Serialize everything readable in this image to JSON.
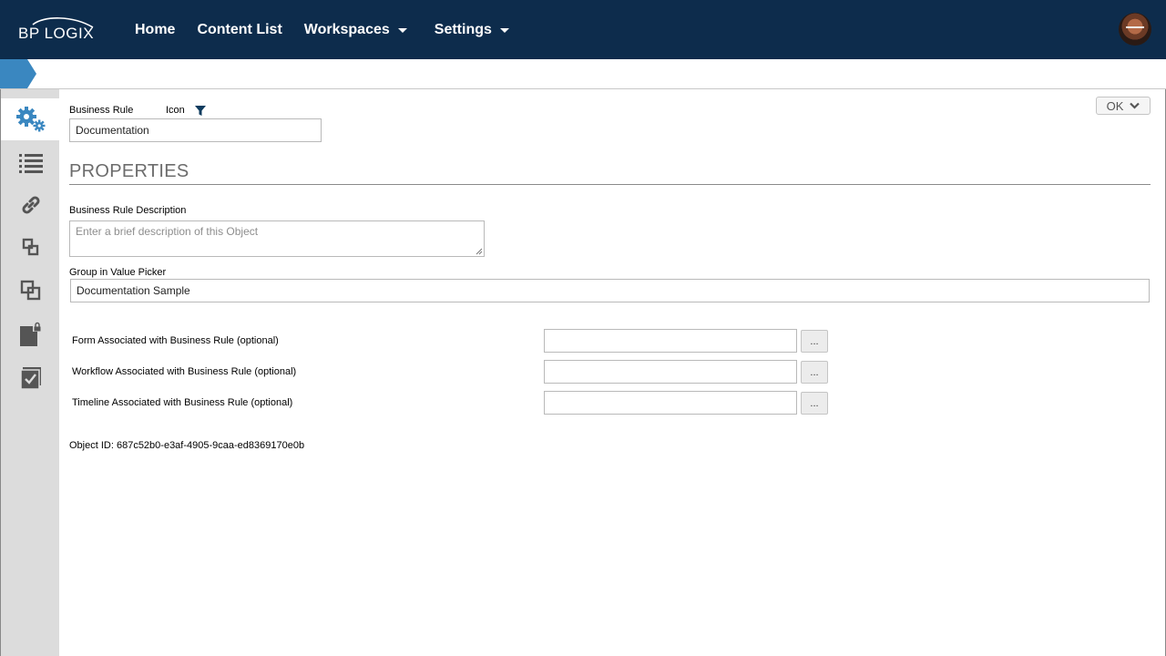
{
  "header": {
    "logo_text": "BP LOGIX",
    "nav": [
      {
        "label": "Home",
        "has_dropdown": false
      },
      {
        "label": "Content List",
        "has_dropdown": false
      },
      {
        "label": "Workspaces",
        "has_dropdown": true
      },
      {
        "label": "Settings",
        "has_dropdown": true
      }
    ],
    "avatar": "user-avatar"
  },
  "sidebar": {
    "items": [
      {
        "icon": "gears-icon",
        "active": true
      },
      {
        "icon": "list-icon",
        "active": false
      },
      {
        "icon": "link-icon",
        "active": false
      },
      {
        "icon": "squares-icon",
        "active": false
      },
      {
        "icon": "copy-icon",
        "active": false
      },
      {
        "icon": "locked-document-icon",
        "active": false
      },
      {
        "icon": "checked-clipboard-icon",
        "active": false
      }
    ]
  },
  "form": {
    "name_label": "Business Rule",
    "icon_label": "Icon",
    "name_value": "Documentation",
    "ok_label": "OK",
    "section_title": "PROPERTIES",
    "description_label": "Business Rule Description",
    "description_placeholder": "Enter a brief description of this Object",
    "group_label": "Group in Value Picker",
    "group_value": "Documentation Sample",
    "associations": [
      {
        "label": "Form Associated with Business Rule (optional)",
        "value": "",
        "button": "..."
      },
      {
        "label": "Workflow Associated with Business Rule (optional)",
        "value": "",
        "button": "..."
      },
      {
        "label": "Timeline Associated with Business Rule (optional)",
        "value": "",
        "button": "..."
      }
    ],
    "object_id": "Object ID: 687c52b0-e3af-4905-9caa-ed8369170e0b"
  },
  "colors": {
    "header_bg": "#0d2c4c",
    "accent_blue": "#3a87c0",
    "sidebar_bg": "#dcdcdc",
    "icon_gray": "#555555"
  }
}
